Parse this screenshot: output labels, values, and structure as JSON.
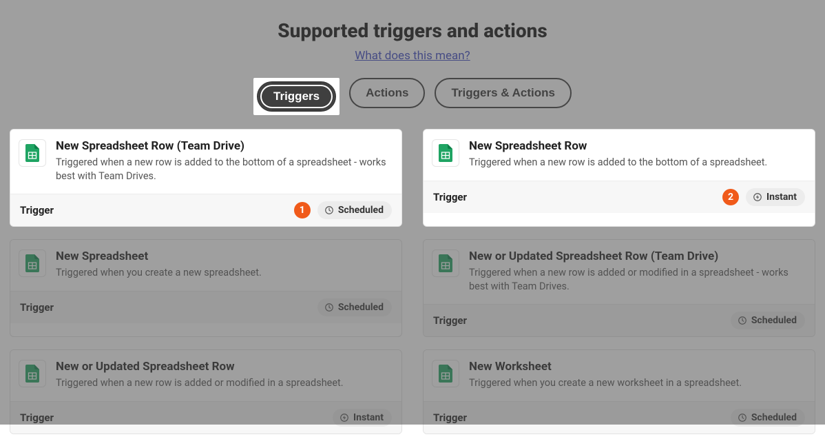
{
  "header": {
    "title": "Supported triggers and actions",
    "help_link": "What does this mean?"
  },
  "tabs": {
    "triggers": "Triggers",
    "actions": "Actions",
    "both": "Triggers & Actions"
  },
  "cards": [
    {
      "title": "New Spreadsheet Row (Team Drive)",
      "desc": "Triggered when a new row is added to the bottom of a spreadsheet - works best with Team Drives.",
      "type": "Trigger",
      "timing": "Scheduled",
      "badge": "1",
      "highlight": true
    },
    {
      "title": "New Spreadsheet Row",
      "desc": "Triggered when a new row is added to the bottom of a spreadsheet.",
      "type": "Trigger",
      "timing": "Instant",
      "badge": "2",
      "highlight": true
    },
    {
      "title": "New Spreadsheet",
      "desc": "Triggered when you create a new spreadsheet.",
      "type": "Trigger",
      "timing": "Scheduled",
      "badge": null,
      "highlight": false
    },
    {
      "title": "New or Updated Spreadsheet Row (Team Drive)",
      "desc": "Triggered when a new row is added or modified in a spreadsheet - works best with Team Drives.",
      "type": "Trigger",
      "timing": "Scheduled",
      "badge": null,
      "highlight": false
    },
    {
      "title": "New or Updated Spreadsheet Row",
      "desc": "Triggered when a new row is added or modified in a spreadsheet.",
      "type": "Trigger",
      "timing": "Instant",
      "badge": null,
      "highlight": false
    },
    {
      "title": "New Worksheet",
      "desc": "Triggered when you create a new worksheet in a spreadsheet.",
      "type": "Trigger",
      "timing": "Scheduled",
      "badge": null,
      "highlight": false
    }
  ]
}
